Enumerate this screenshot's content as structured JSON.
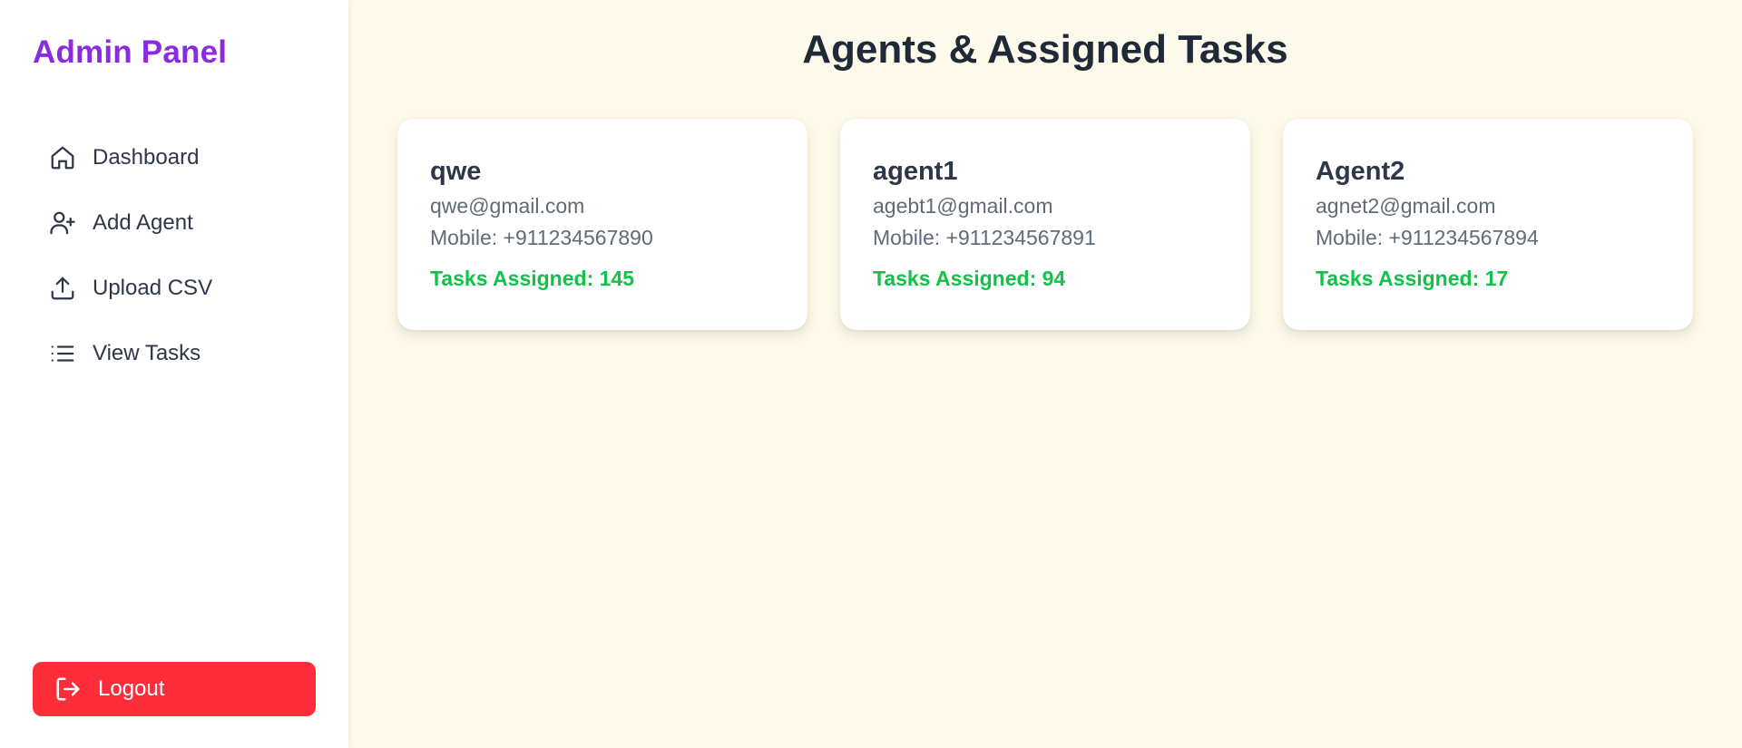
{
  "sidebar": {
    "brand": "Admin Panel",
    "items": [
      {
        "label": "Dashboard",
        "icon": "home-icon"
      },
      {
        "label": "Add Agent",
        "icon": "user-plus-icon"
      },
      {
        "label": "Upload CSV",
        "icon": "upload-icon"
      },
      {
        "label": "View Tasks",
        "icon": "list-icon"
      }
    ],
    "logout_label": "Logout"
  },
  "main": {
    "title": "Agents & Assigned Tasks",
    "agents": [
      {
        "name": "qwe",
        "email": "qwe@gmail.com",
        "mobile": "Mobile: +911234567890",
        "tasks": "Tasks Assigned: 145"
      },
      {
        "name": "agent1",
        "email": "agebt1@gmail.com",
        "mobile": "Mobile: +911234567891",
        "tasks": "Tasks Assigned: 94"
      },
      {
        "name": "Agent2",
        "email": "agnet2@gmail.com",
        "mobile": "Mobile: +911234567894",
        "tasks": "Tasks Assigned: 17"
      }
    ]
  },
  "colors": {
    "brand": "#8a2be2",
    "background": "#fefaeb",
    "logout": "#ff2d3a",
    "tasks": "#12c24b",
    "text_dark": "#1f2937"
  }
}
